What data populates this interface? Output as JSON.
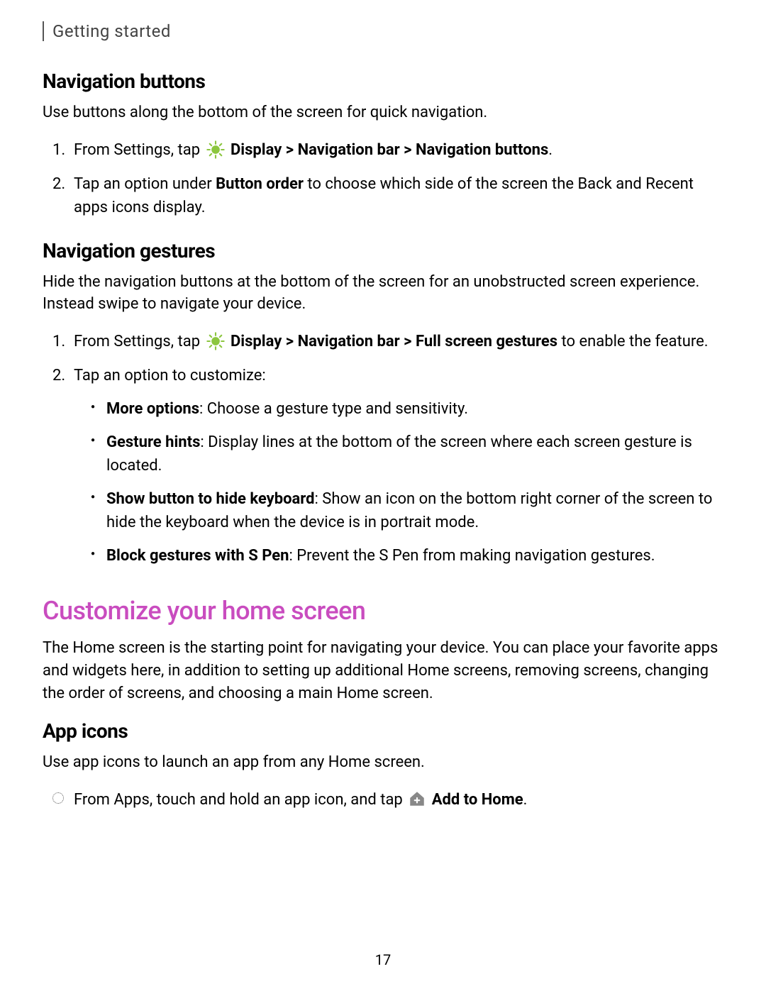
{
  "header": "Getting started",
  "section1": {
    "title": "Navigation buttons",
    "desc": "Use buttons along the bottom of the screen for quick navigation.",
    "step1_pre": "From Settings, tap ",
    "step1_bold": "Display > Navigation bar > Navigation buttons",
    "step1_post": ".",
    "step2_pre": "Tap an option under ",
    "step2_bold": "Button order",
    "step2_post": " to choose which side of the screen the Back and Recent apps icons display."
  },
  "section2": {
    "title": "Navigation gestures",
    "desc": "Hide the navigation buttons at the bottom of the screen for an unobstructed screen experience. Instead swipe to navigate your device.",
    "step1_pre": "From Settings, tap ",
    "step1_bold": "Display > Navigation bar > Full screen gestures",
    "step1_post": " to enable the feature.",
    "step2": "Tap an option to customize:",
    "bullets": {
      "b1_bold": "More options",
      "b1_post": ": Choose a gesture type and sensitivity.",
      "b2_bold": "Gesture hints",
      "b2_post": ": Display lines at the bottom of the screen where each screen gesture is located.",
      "b3_bold": "Show button to hide keyboard",
      "b3_post": ": Show an icon on the bottom right corner of the screen to hide the keyboard when the device is in portrait mode.",
      "b4_bold": "Block gestures with S Pen",
      "b4_post": ": Prevent the S Pen from making navigation gestures."
    }
  },
  "section3": {
    "title": "Customize your home screen",
    "desc": "The Home screen is the starting point for navigating your device. You can place your favorite apps and widgets here, in addition to setting up additional Home screens, removing screens, changing the order of screens, and choosing a main Home screen."
  },
  "section4": {
    "title": "App icons",
    "desc": "Use app icons to launch an app from any Home screen.",
    "bullet_pre": "From Apps, touch and hold an app icon, and tap ",
    "bullet_bold": "Add to Home",
    "bullet_post": "."
  },
  "pageNum": "17"
}
